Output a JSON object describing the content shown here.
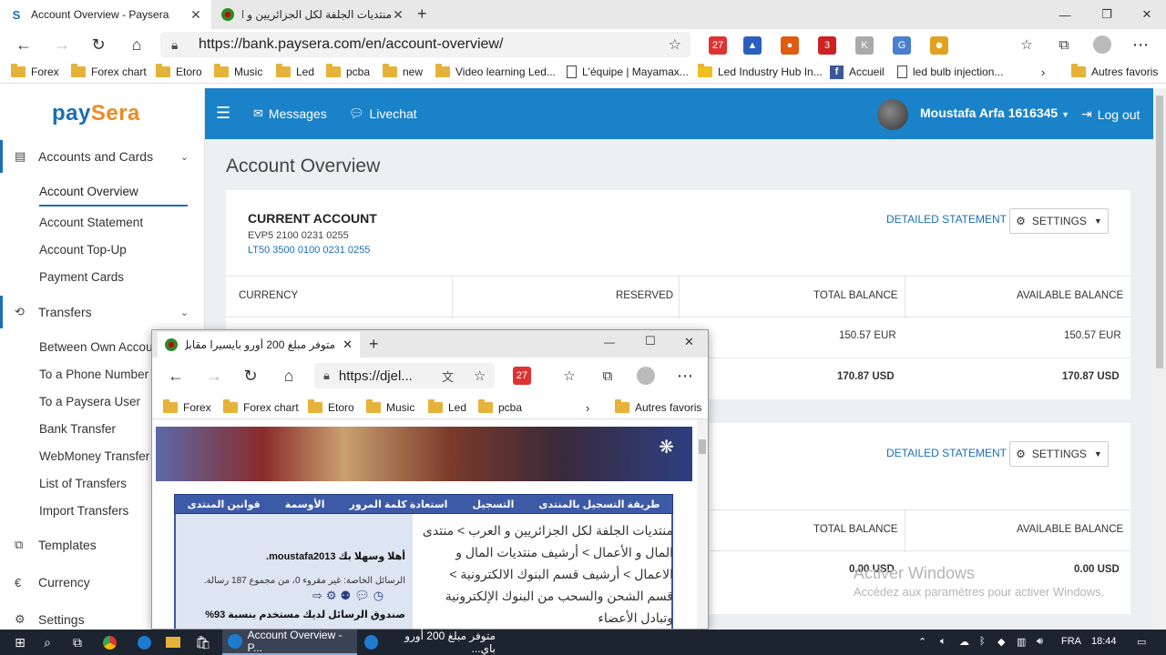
{
  "browser": {
    "tabs": [
      {
        "title": "Account Overview - Paysera",
        "favicon": "paysera-icon"
      },
      {
        "title": "منتديات الجلفة لكل الجزائريين و الع",
        "favicon": "djelfa-icon"
      }
    ],
    "url": "https://bank.paysera.com/en/account-overview/",
    "extension_badges": {
      "mail": "27",
      "abp": "3"
    },
    "bookmarks": [
      {
        "label": "Forex",
        "type": "folder"
      },
      {
        "label": "Forex chart",
        "type": "folder"
      },
      {
        "label": "Etoro",
        "type": "folder"
      },
      {
        "label": "Music",
        "type": "folder"
      },
      {
        "label": "Led",
        "type": "folder"
      },
      {
        "label": "pcba",
        "type": "folder"
      },
      {
        "label": "new",
        "type": "folder"
      },
      {
        "label": "Video learning Led...",
        "type": "folder"
      },
      {
        "label": "L'équipe | Mayamax...",
        "type": "page"
      },
      {
        "label": "Led Industry Hub In...",
        "type": "page"
      },
      {
        "label": "Accueil",
        "type": "page"
      },
      {
        "label": "led bulb injection...",
        "type": "page"
      }
    ],
    "other_bookmarks": "Autres favoris"
  },
  "sidebar": {
    "logo_a": "pay",
    "logo_b": "Sera",
    "accounts_header": "Accounts and Cards",
    "accounts_items": [
      "Account Overview",
      "Account Statement",
      "Account Top-Up",
      "Payment Cards"
    ],
    "transfers_header": "Transfers",
    "transfers_items": [
      "Between Own Accounts",
      "To a Phone Number",
      "To a Paysera User",
      "Bank Transfer",
      "WebMoney Transfer",
      "List of Transfers",
      "Import Transfers"
    ],
    "templates": "Templates",
    "currency": "Currency",
    "settings": "Settings"
  },
  "topnav": {
    "messages": "Messages",
    "livechat": "Livechat",
    "user": "Moustafa Arfa 1616345",
    "logout": "Log out"
  },
  "main": {
    "title": "Account Overview",
    "card1": {
      "name": "CURRENT ACCOUNT",
      "evp": "EVP5 2100 0231 0255",
      "iban": "LT50 3500 0100 0231 0255",
      "detail_link": "DETAILED STATEMENT",
      "settings": "SETTINGS",
      "headers": [
        "CURRENCY",
        "RESERVED",
        "TOTAL BALANCE",
        "AVAILABLE BALANCE"
      ],
      "rows": [
        {
          "total": "150.57 EUR",
          "available": "150.57 EUR"
        },
        {
          "total": "170.87 USD",
          "available": "170.87 USD"
        }
      ]
    },
    "card2": {
      "detail_link": "DETAILED STATEMENT",
      "settings": "SETTINGS",
      "headers": [
        "TOTAL BALANCE",
        "AVAILABLE BALANCE"
      ],
      "row": {
        "total": "0.00 USD",
        "available": "0.00 USD"
      }
    }
  },
  "watermark": {
    "line1": "Activer Windows",
    "line2": "Accédez aux paramètres pour activer Windows."
  },
  "popup": {
    "tab_title": "متوفر مبلغ 200 أورو بايسيرا مقابل",
    "url": "https://djel...",
    "bookmarks": [
      "Forex",
      "Forex chart",
      "Etoro",
      "Music",
      "Led",
      "pcba"
    ],
    "other_bookmarks": "Autres favoris",
    "mail_badge": "27",
    "forum_nav": [
      "طريقة التسجيل بالمنتدى",
      "التسجيل",
      "استعادة كلمة المرور",
      "الأوسمة",
      "قوانين المنتدى"
    ],
    "hello": "أهلا وسهلا بك moustafa2013.",
    "pm": "الرسائل الخاصة: غير مقروء 0، من مجموع 187 رسالة.",
    "box": "صندوق الرسائل لديك مستخدم بنسبة 93%",
    "breadcrumb": "منتديات الجلفة لكل الجزائريين و العرب > منتدى المال و الأعمال > أرشيف منتديات المال و الاعمال > أرشيف قسم البنوك الالكترونية > قسم الشحن والسحب من البنوك الإلكترونية وتبادل الأعضاء"
  },
  "taskbar": {
    "task1": "Account Overview - P...",
    "task2": "متوفر مبلغ 200 أورو باي...",
    "lang": "FRA",
    "time": "18:44"
  }
}
